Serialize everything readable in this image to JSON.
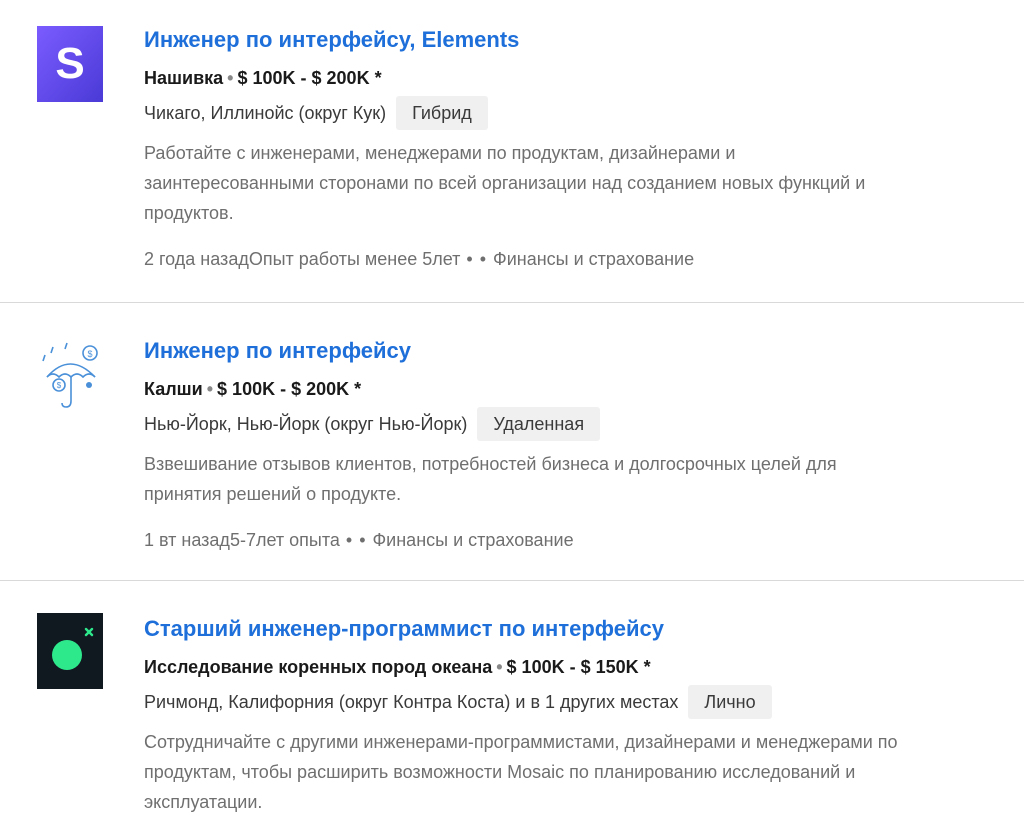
{
  "jobs": [
    {
      "title": "Инженер по интерфейсу, Elements",
      "company": "Нашивка",
      "separator": "•",
      "salary": "$ 100K - $ 200K *",
      "location": "Чикаго, Иллинойс (округ Кук)",
      "work_type": "Гибрид",
      "description": "Работайте с инженерами, менеджерами по продуктам, дизайнерами и заинтересованными сторонами по всей организации над созданием новых функций и продуктов.",
      "posted": "2 года назад",
      "experience": "Опыт работы менее 5лет",
      "dots": "• •",
      "industry": "Финансы и страхование",
      "logo_letter": "S",
      "logo_color": "#6c4cf4"
    },
    {
      "title": "Инженер по интерфейсу",
      "company": "Калши",
      "separator": "•",
      "salary": "$ 100K - $ 200K *",
      "location": "Нью-Йорк, Нью-Йорк (округ Нью-Йорк)",
      "work_type": "Удаленная",
      "description": "Взвешивание отзывов клиентов, потребностей бизнеса и долгосрочных целей для принятия решений о продукте.",
      "posted": "1 вт назад",
      "experience": "5-7лет опыта",
      "dots": "• •",
      "industry": "Финансы и страхование",
      "logo_color": "#4a90d9"
    },
    {
      "title": "Старший инженер-программист по интерфейсу",
      "company": "Исследование коренных пород океана",
      "separator": "•",
      "salary": "$ 100K - $ 150K *",
      "location": "Ричмонд, Калифорния (округ Контра Коста) и в 1 других местах",
      "work_type": "Лично",
      "description": "Сотрудничайте с другими инженерами-программистами, дизайнерами и менеджерами по продуктам, чтобы расширить возможности Mosaic по планированию исследований и эксплуатации.",
      "logo_color": "#101820",
      "logo_accent": "#2ee88c"
    }
  ]
}
